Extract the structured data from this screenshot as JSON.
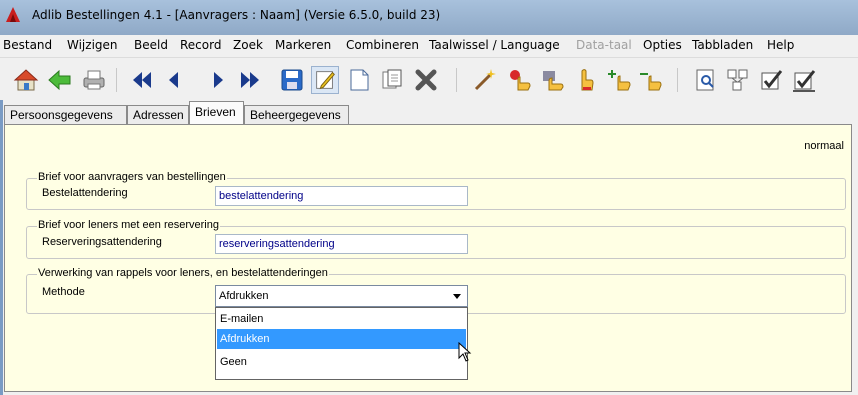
{
  "window": {
    "title": "Adlib Bestellingen 4.1 - [Aanvragers : Naam] (Versie 6.5.0, build 23)"
  },
  "menu": {
    "items": [
      {
        "label": "Bestand"
      },
      {
        "label": "Wijzigen"
      },
      {
        "label": "Beeld"
      },
      {
        "label": "Record"
      },
      {
        "label": "Zoek"
      },
      {
        "label": "Markeren"
      },
      {
        "label": "Combineren"
      },
      {
        "label": "Taalwissel / Language"
      },
      {
        "label": "Data-taal",
        "disabled": true
      },
      {
        "label": "Opties"
      },
      {
        "label": "Tabbladen"
      },
      {
        "label": "Help"
      }
    ]
  },
  "toolbar": {
    "buttons": [
      "home-icon",
      "back-arrow-icon",
      "print-icon",
      "first-record-icon",
      "previous-record-icon",
      "next-record-icon",
      "last-record-icon",
      "save-icon",
      "edit-icon",
      "new-record-icon",
      "copy-record-icon",
      "delete-icon",
      "wand-icon",
      "hand-derive-icon",
      "hand-link-icon",
      "hand-pointer-icon",
      "hand-add-icon",
      "hand-remove-icon",
      "search-form-icon",
      "thesaurus-icon",
      "check-icon",
      "check-all-icon"
    ]
  },
  "tabs": [
    {
      "label": "Persoonsgegevens",
      "selected": false
    },
    {
      "label": "Adressen",
      "selected": false
    },
    {
      "label": "Brieven",
      "selected": true
    },
    {
      "label": "Beheergegevens",
      "selected": false
    }
  ],
  "panel": {
    "mode": "normaal",
    "group1": {
      "legend": "Brief voor aanvragers van bestellingen",
      "label": "Bestelattendering",
      "value": "bestelattendering"
    },
    "group2": {
      "legend": "Brief voor leners met een reservering",
      "label": "Reserveringsattendering",
      "value": "reserveringsattendering"
    },
    "group3": {
      "legend": "Verwerking van rappels voor leners, en bestelattenderingen",
      "label": "Methode",
      "selected": "Afdrukken",
      "options": [
        "E-mailen",
        "Afdrukken",
        "Geen"
      ],
      "highlighted_index": 1
    }
  }
}
